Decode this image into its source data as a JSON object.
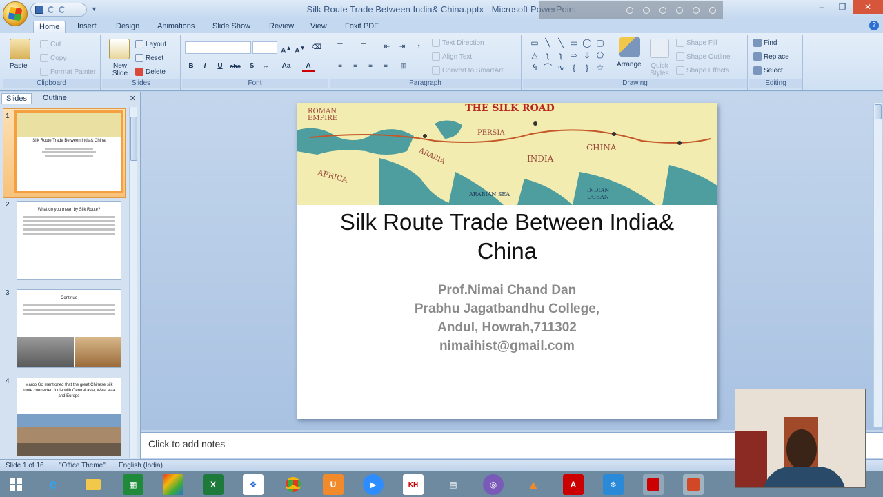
{
  "window": {
    "title": "Silk Route Trade Between India& China.pptx - Microsoft PowerPoint"
  },
  "ribbon_tabs": [
    "Home",
    "Insert",
    "Design",
    "Animations",
    "Slide Show",
    "Review",
    "View",
    "Foxit PDF"
  ],
  "ribbon": {
    "clipboard": {
      "paste": "Paste",
      "cut": "Cut",
      "copy": "Copy",
      "format_painter": "Format Painter",
      "label": "Clipboard"
    },
    "slides": {
      "new_slide": "New Slide",
      "layout": "Layout",
      "reset": "Reset",
      "delete": "Delete",
      "label": "Slides"
    },
    "font": {
      "label": "Font"
    },
    "paragraph": {
      "text_direction": "Text Direction",
      "align_text": "Align Text",
      "smartart": "Convert to SmartArt",
      "label": "Paragraph"
    },
    "drawing": {
      "arrange": "Arrange",
      "quick_styles": "Quick Styles",
      "shape_fill": "Shape Fill",
      "shape_outline": "Shape Outline",
      "shape_effects": "Shape Effects",
      "label": "Drawing"
    },
    "editing": {
      "find": "Find",
      "replace": "Replace",
      "select": "Select",
      "label": "Editing"
    }
  },
  "pane_tabs": {
    "slides": "Slides",
    "outline": "Outline"
  },
  "thumbnails": [
    {
      "num": "1",
      "title": "Silk Route Trade Between India& China"
    },
    {
      "num": "2",
      "title": "What do you mean by Silk Route?"
    },
    {
      "num": "3",
      "title": "Continue"
    },
    {
      "num": "4",
      "title": "Marco Go mentioned that the great Chinese silk route connected India with Central asia, West asia and Europe"
    }
  ],
  "slide": {
    "map_title": "THE SILK ROAD",
    "map_labels": [
      "ROMAN EMPIRE",
      "AFRICA",
      "ARABIA",
      "PERSIA",
      "INDIA",
      "CHINA",
      "ARABIAN SEA",
      "INDIAN OCEAN"
    ],
    "title": "Silk Route Trade Between India& China",
    "subtitle_lines": [
      "Prof.Nimai Chand Dan",
      "Prabhu Jagatbandhu College,",
      "Andul, Howrah,711302",
      "nimaihist@gmail.com"
    ]
  },
  "notes_placeholder": "Click to add notes",
  "status": {
    "slide_of": "Slide 1 of 16",
    "theme": "\"Office Theme\"",
    "language": "English (India)"
  },
  "colors": {
    "ribbon_bg": "#dbe7f5",
    "canvas_bg": "#b5cbe6",
    "selection": "#f5a040",
    "taskbar": "#6d8aa0"
  }
}
